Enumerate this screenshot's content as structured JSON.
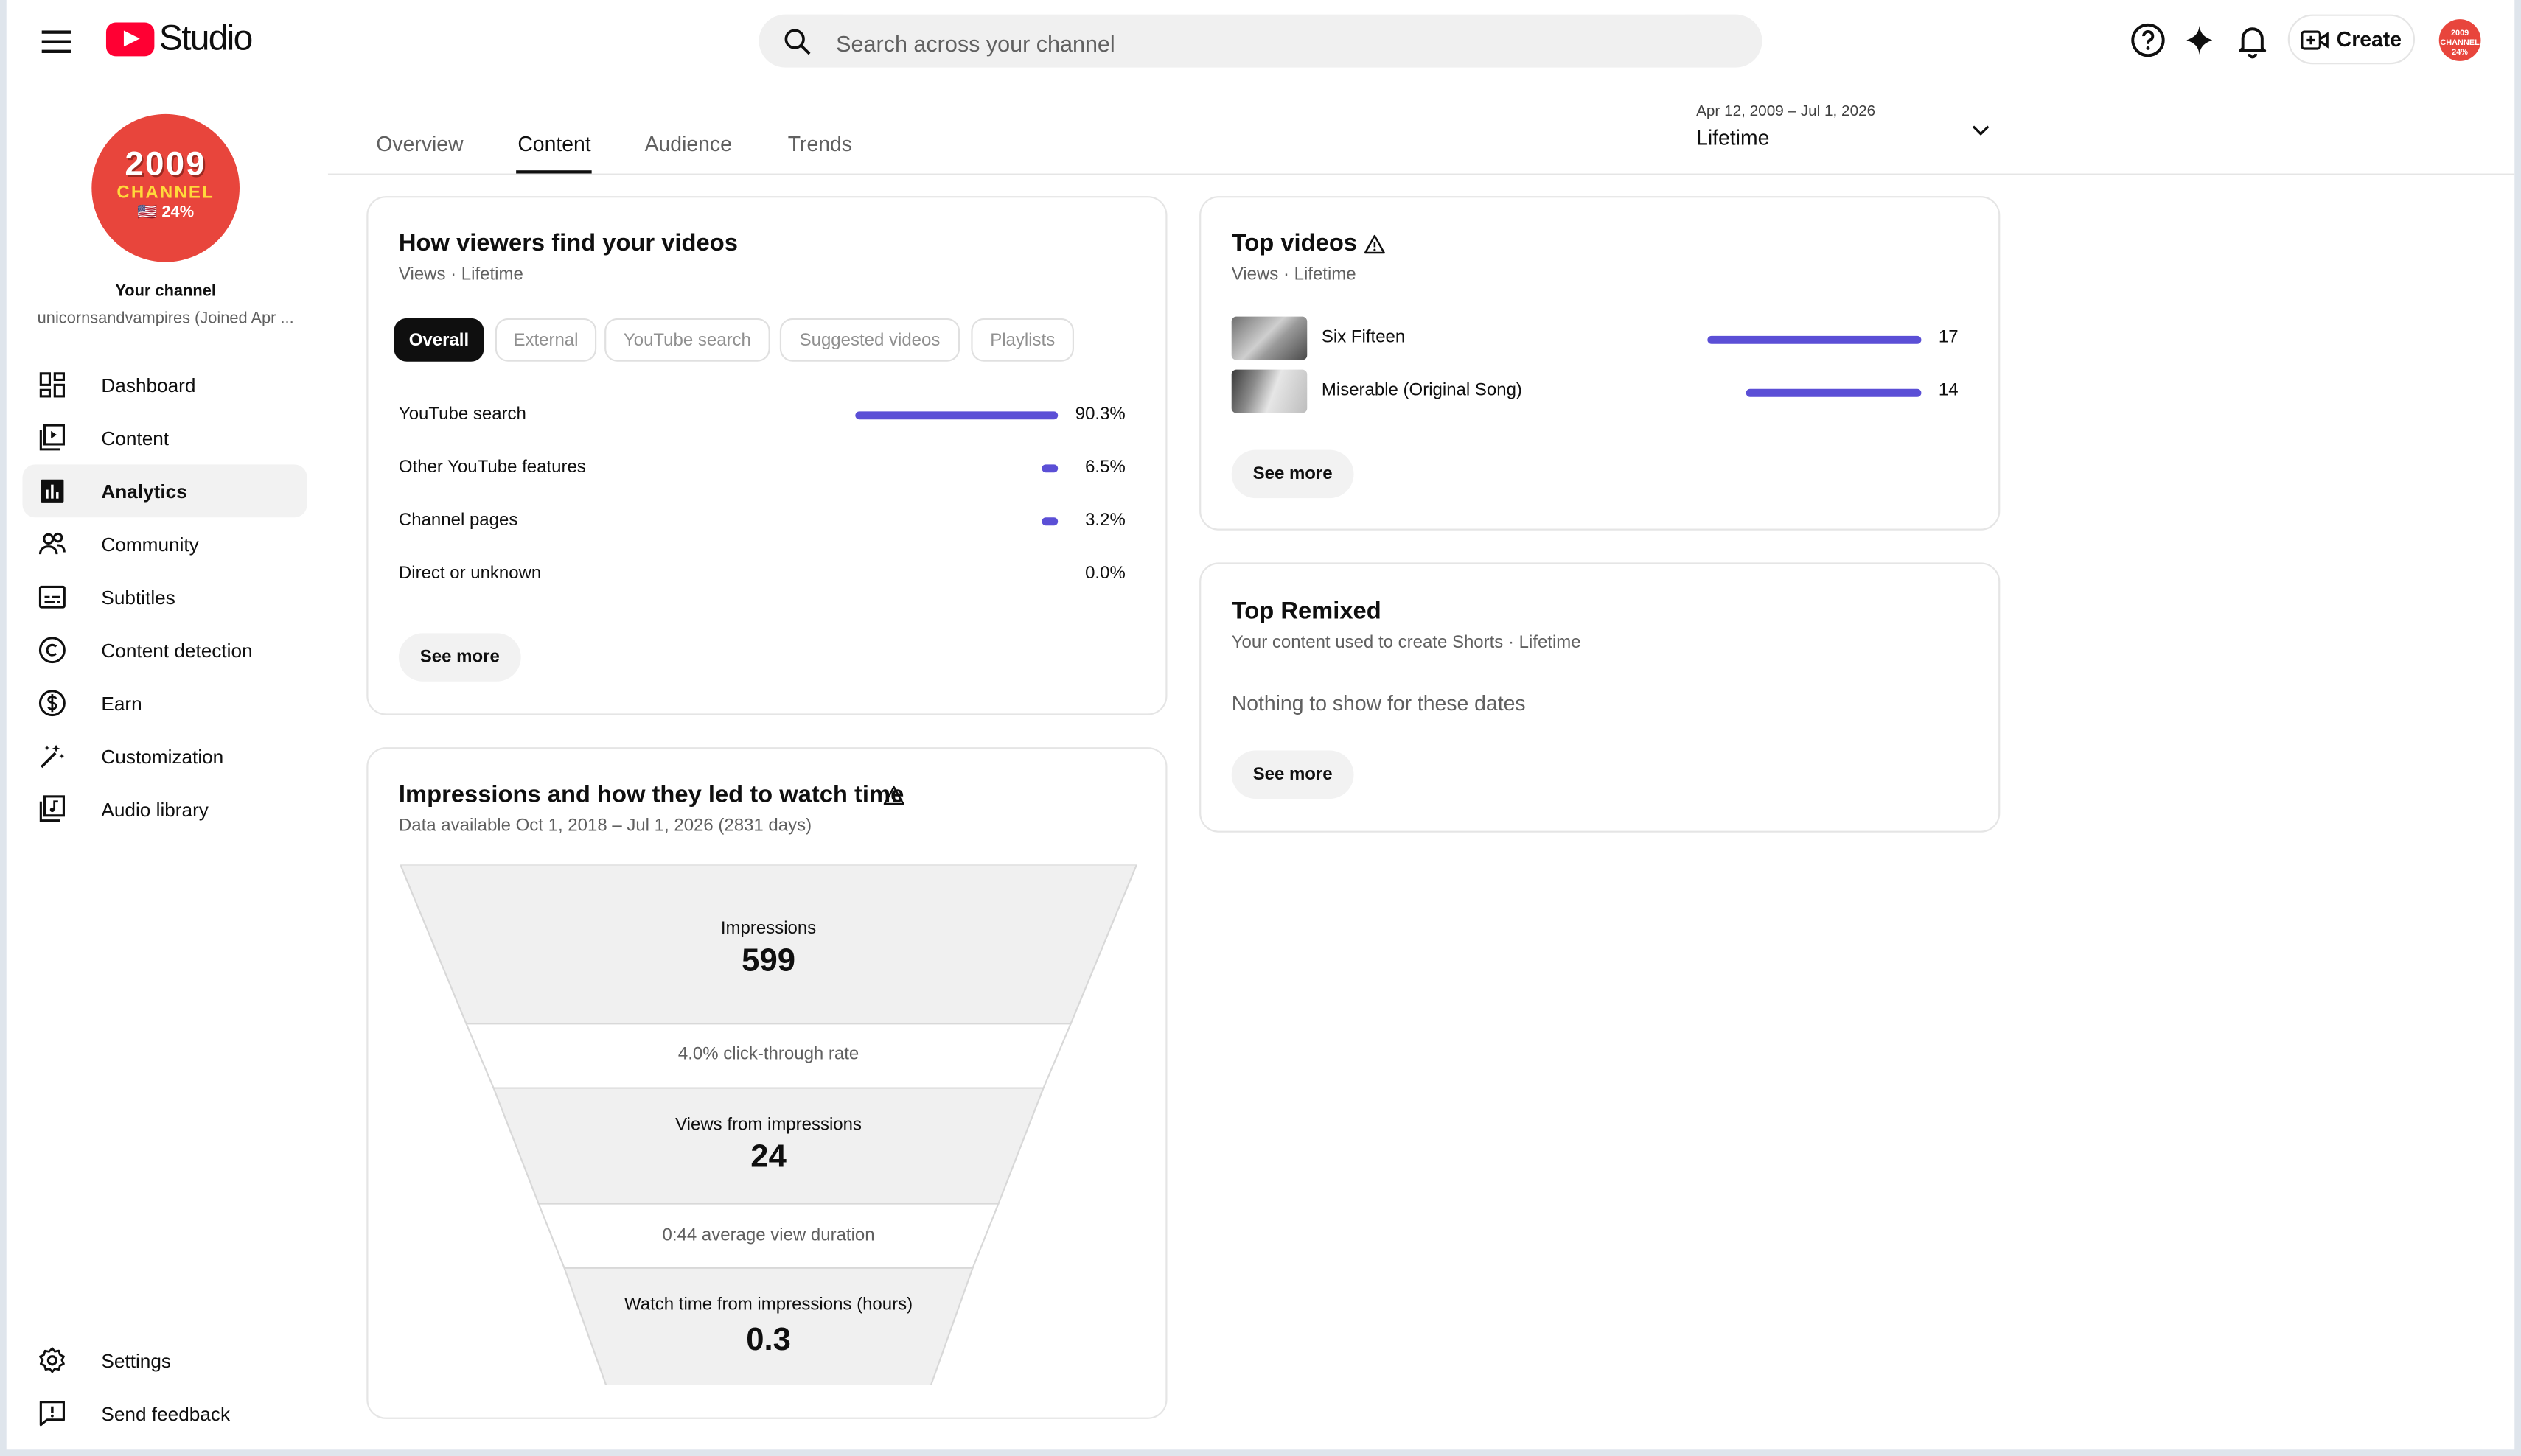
{
  "header": {
    "logo_text": "Studio",
    "search_placeholder": "Search across your channel",
    "create_label": "Create",
    "avatar_text": "2009 CHANNEL 24%"
  },
  "sidebar": {
    "avatar_line1": "2009",
    "avatar_line2": "CHANNEL",
    "avatar_line3": "🇺🇸 24%",
    "your_channel": "Your channel",
    "channel_name": "unicornsandvampires (Joined Apr ...",
    "items": [
      {
        "label": "Dashboard",
        "icon": "dashboard-icon"
      },
      {
        "label": "Content",
        "icon": "content-icon"
      },
      {
        "label": "Analytics",
        "icon": "analytics-icon",
        "active": true
      },
      {
        "label": "Community",
        "icon": "community-icon"
      },
      {
        "label": "Subtitles",
        "icon": "subtitles-icon"
      },
      {
        "label": "Content detection",
        "icon": "copyright-icon"
      },
      {
        "label": "Earn",
        "icon": "dollar-icon"
      },
      {
        "label": "Customization",
        "icon": "magic-wand-icon"
      },
      {
        "label": "Audio library",
        "icon": "audio-library-icon"
      }
    ],
    "bottom": [
      {
        "label": "Settings",
        "icon": "gear-icon"
      },
      {
        "label": "Send feedback",
        "icon": "feedback-icon"
      }
    ]
  },
  "tabs": [
    "Overview",
    "Content",
    "Audience",
    "Trends"
  ],
  "active_tab": "Content",
  "date_range": {
    "dates": "Apr 12, 2009 – Jul 1, 2026",
    "label": "Lifetime"
  },
  "traffic": {
    "title": "How viewers find your videos",
    "subtitle": "Views · Lifetime",
    "chips": [
      "Overall",
      "External",
      "YouTube search",
      "Suggested videos",
      "Playlists"
    ],
    "rows": [
      {
        "label": "YouTube search",
        "value": "90.3%",
        "fraction": 0.903
      },
      {
        "label": "Other YouTube features",
        "value": "6.5%",
        "fraction": 0.065
      },
      {
        "label": "Channel pages",
        "value": "3.2%",
        "fraction": 0.032
      },
      {
        "label": "Direct or unknown",
        "value": "0.0%",
        "fraction": 0.0
      }
    ],
    "see_more": "See more"
  },
  "impressions": {
    "title": "Impressions and how they led to watch time",
    "subtitle": "Data available Oct 1, 2018 – Jul 1, 2026 (2831 days)",
    "impressions_label": "Impressions",
    "impressions_value": "599",
    "ctr_text": "4.0% click-through rate",
    "views_label": "Views from impressions",
    "views_value": "24",
    "avd_text": "0:44 average view duration",
    "watch_label": "Watch time from impressions (hours)",
    "watch_value": "0.3"
  },
  "top_videos": {
    "title": "Top videos",
    "subtitle": "Views · Lifetime",
    "videos": [
      {
        "title": "Six Fifteen",
        "views": "17",
        "fraction": 1.0
      },
      {
        "title": "Miserable (Original Song)",
        "views": "14",
        "fraction": 0.82
      }
    ],
    "see_more": "See more"
  },
  "top_remixed": {
    "title": "Top Remixed",
    "subtitle": "Your content used to create Shorts · Lifetime",
    "empty": "Nothing to show for these dates",
    "see_more": "See more"
  },
  "colors": {
    "accent": "#5b4fd6",
    "brand": "#ff0033",
    "avatar": "#e8453c"
  }
}
